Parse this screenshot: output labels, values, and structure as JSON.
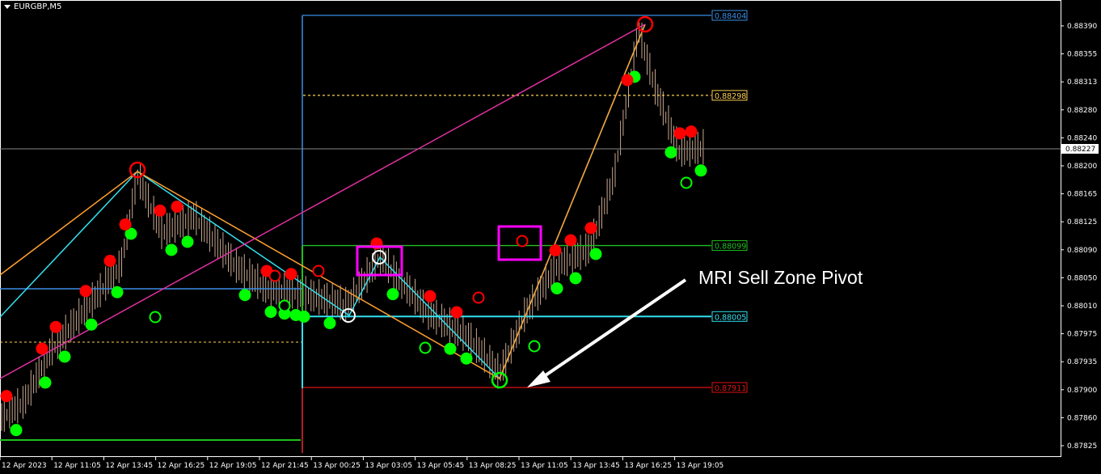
{
  "symbol": "EURGBP,M5",
  "annotation": "MRI Sell Zone Pivot",
  "colors": {
    "background": "#000000",
    "axis": "#ffffff",
    "bull_marker": "#00ff00",
    "bear_marker": "#ff0000",
    "zone_box": "#ff00ff",
    "line_blue": "#3a8ee6",
    "line_green": "#1fc01f",
    "line_cyan": "#33e0f0",
    "line_red": "#e01010",
    "line_orange": "#ffa030",
    "line_magenta": "#e030a0",
    "line_dotted": "#ffd050",
    "candles": "#c8a890"
  },
  "chart_data": {
    "type": "candlestick",
    "price_axis_ticks": [
      "0.88390",
      "0.88355",
      "0.88313",
      "0.88280",
      "0.88240",
      "0.88200",
      "0.88165",
      "0.88125",
      "0.88090",
      "0.88050",
      "0.88010",
      "0.87975",
      "0.87935",
      "0.87900",
      "0.87860",
      "0.87825"
    ],
    "time_axis_ticks": [
      "12 Apr 2023",
      "12 Apr 11:05",
      "12 Apr 13:45",
      "12 Apr 16:25",
      "12 Apr 19:05",
      "12 Apr 21:45",
      "13 Apr 00:25",
      "13 Apr 03:05",
      "13 Apr 05:45",
      "13 Apr 08:25",
      "13 Apr 11:05",
      "13 Apr 13:45",
      "13 Apr 16:25",
      "13 Apr 19:05"
    ],
    "current_price": "0.88227",
    "levels": [
      {
        "name": "high",
        "label": "0.88404",
        "price": 0.88404,
        "color": "#3a8ee6"
      },
      {
        "name": "dotted",
        "label": "0.88298",
        "price": 0.88298,
        "color": "#ffd050"
      },
      {
        "name": "green",
        "label": "0.88099",
        "price": 0.88099,
        "color": "#1fc01f"
      },
      {
        "name": "cyan",
        "label": "0.88005",
        "price": 0.88005,
        "color": "#33e0f0"
      },
      {
        "name": "low",
        "label": "0.87911",
        "price": 0.87911,
        "color": "#e01010"
      }
    ],
    "green_markers_x": [
      20,
      56,
      80,
      113,
      145,
      162,
      212,
      232,
      303,
      335,
      352,
      366,
      376,
      408,
      486,
      557,
      577,
      689,
      712,
      737,
      785,
      830,
      867
    ],
    "red_markers_x": [
      8,
      52,
      69,
      106,
      136,
      155,
      198,
      219,
      330,
      360,
      466,
      532,
      565,
      687,
      706,
      731,
      776,
      841,
      855
    ]
  }
}
